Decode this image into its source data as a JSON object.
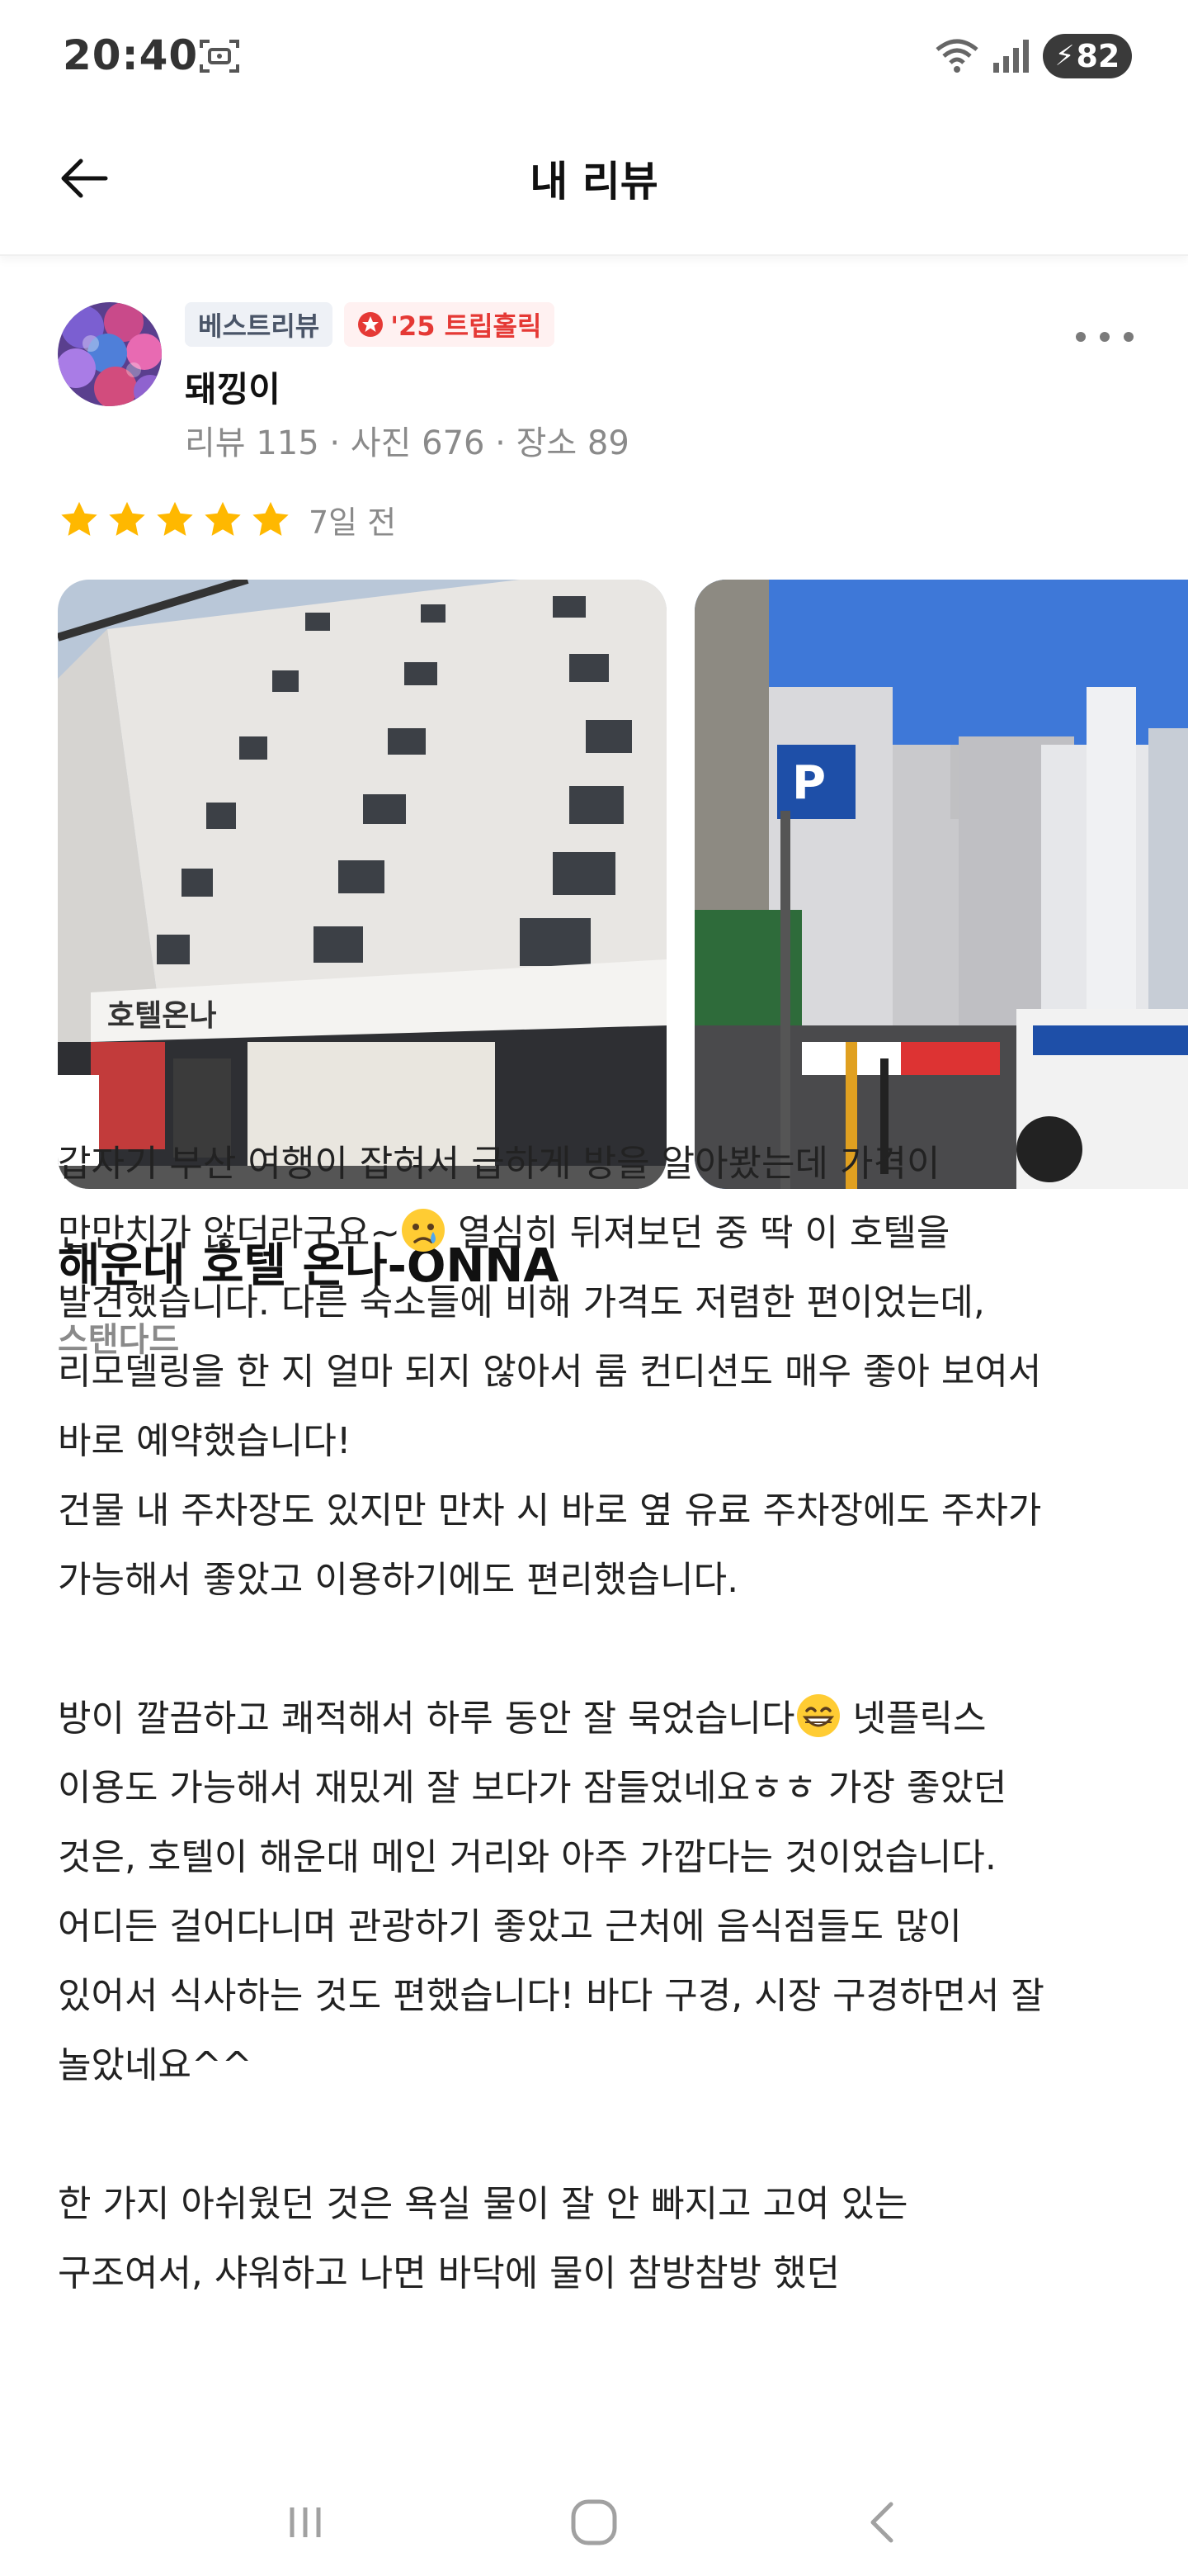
{
  "status_bar": {
    "time": "20:40",
    "battery": "82",
    "icons": [
      "screenshot-icon",
      "wifi-icon",
      "signal-icon",
      "battery-charging-icon"
    ]
  },
  "header": {
    "title": "내 리뷰",
    "back_icon": "arrow-left-icon"
  },
  "review": {
    "badges": {
      "best": "베스트리뷰",
      "trip": "'25 트립홀릭"
    },
    "user_name": "돼낑이",
    "stats": "리뷰 115 · 사진 676 · 장소 89",
    "rating": 5,
    "date": "7일 전",
    "photos": [
      {
        "alt": "hotel-building-photo"
      },
      {
        "alt": "parking-lot-street-photo"
      }
    ],
    "hotel_name": "해운대 호텔 온나-ONNA",
    "room_type": "스탠다드",
    "body": {
      "p1_line1": "갑자기 부산 여행이 잡혀서 급하게 방을 알아봤는데 가격이",
      "p1_line2a": "만만치가 않더라구요~",
      "p1_line2b": " 열심히 뒤져보던 중 딱 이 호텔을",
      "p1_rest": "발견했습니다. 다른 숙소들에 비해 가격도 저렴한 편이었는데,\n리모델링을 한 지 얼마 되지 않아서 룸 컨디션도 매우 좋아 보여서\n바로 예약했습니다!\n건물 내 주차장도 있지만 만차 시 바로 옆 유료 주차장에도 주차가\n가능해서 좋았고 이용하기에도 편리했습니다.",
      "p2_line1a": "방이 깔끔하고 쾌적해서 하루 동안 잘 묵었습니다",
      "p2_line1b": " 넷플릭스",
      "p2_rest": "이용도 가능해서 재밌게 잘 보다가 잠들었네요ㅎㅎ 가장 좋았던\n것은, 호텔이 해운대 메인 거리와 아주 가깝다는 것이었습니다.\n어디든 걸어다니며 관광하기 좋았고 근처에 음식점들도 많이\n있어서 식사하는 것도 편했습니다! 바다 구경, 시장 구경하면서 잘\n놀았네요^^",
      "p3": "한 가지 아쉬웠던 것은 욕실 물이 잘 안 빠지고 고여 있는\n구조여서, 샤워하고 나면 바닥에 물이 참방참방 했던"
    }
  },
  "colors": {
    "star": "#FFB800",
    "trip_red": "#E53935",
    "muted": "#8A8A8A"
  }
}
